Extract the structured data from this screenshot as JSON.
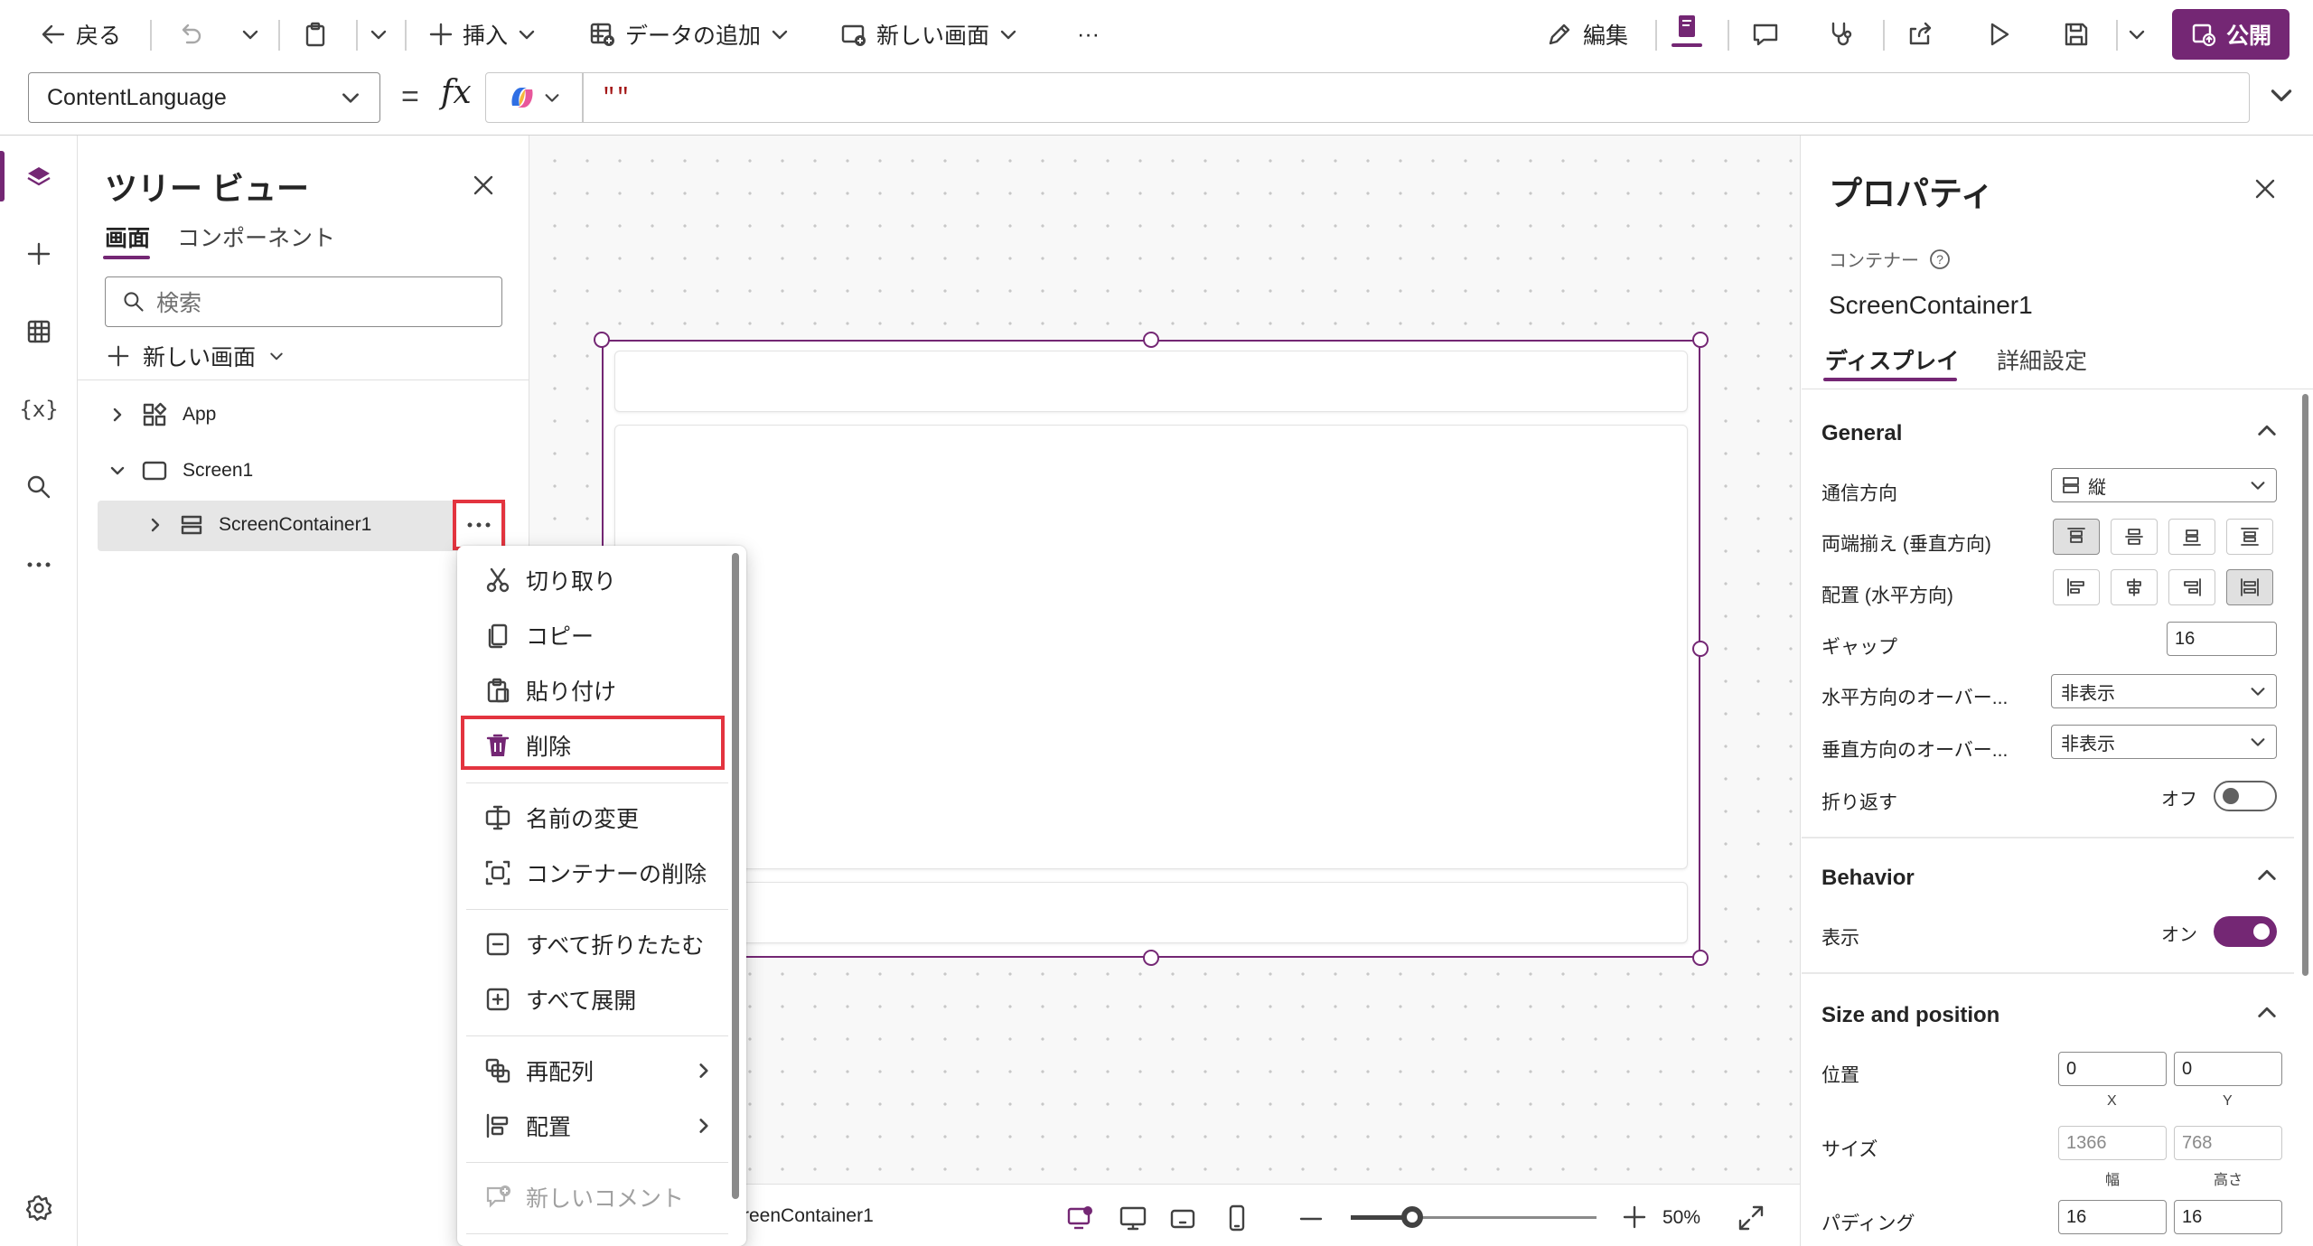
{
  "colors": {
    "accent": "#742774",
    "highlight": "#e3343f"
  },
  "toolbar": {
    "back_label": "戻る",
    "insert_label": "挿入",
    "add_data_label": "データの追加",
    "new_screen_label": "新しい画面",
    "more_label": "···",
    "edit_label": "編集",
    "publish_label": "公開"
  },
  "formula": {
    "property": "ContentLanguage",
    "equals": "=",
    "fx": "fx",
    "value": "\"\""
  },
  "tree": {
    "title": "ツリー ビュー",
    "tabs": [
      "画面",
      "コンポーネント"
    ],
    "search_placeholder": "検索",
    "new_screen_label": "新しい画面",
    "nodes": [
      "App",
      "Screen1",
      "ScreenContainer1"
    ]
  },
  "context_menu": {
    "items": [
      "切り取り",
      "コピー",
      "貼り付け",
      "削除",
      "名前の変更",
      "コンテナーの削除",
      "すべて折りたたむ",
      "すべて展開",
      "再配列",
      "配置",
      "新しいコメント"
    ]
  },
  "canvas": {
    "status_name": "reenContainer1",
    "zoom_value": "50%",
    "zoom_fraction": 0.25
  },
  "properties": {
    "title": "プロパティ",
    "control_type": "コンテナー",
    "control_name": "ScreenContainer1",
    "tabs": [
      "ディスプレイ",
      "詳細設定"
    ],
    "general": {
      "title": "General",
      "direction_label": "通信方向",
      "direction_value": "縦",
      "justify_label": "両端揃え (垂直方向)",
      "align_label": "配置 (水平方向)",
      "gap_label": "ギャップ",
      "gap_value": "16",
      "overflow_h_label": "水平方向のオーバー...",
      "overflow_h_value": "非表示",
      "overflow_v_label": "垂直方向のオーバー...",
      "overflow_v_value": "非表示",
      "wrap_label": "折り返す",
      "wrap_state": "オフ"
    },
    "behavior": {
      "title": "Behavior",
      "visible_label": "表示",
      "visible_state": "オン"
    },
    "size_position": {
      "title": "Size and position",
      "position_label": "位置",
      "x_value": "0",
      "y_value": "0",
      "x_label": "X",
      "y_label": "Y",
      "size_label": "サイズ",
      "width_value": "1366",
      "height_value": "768",
      "width_label": "幅",
      "height_label": "高さ",
      "padding_label": "パディング",
      "padding_1": "16",
      "padding_2": "16"
    }
  }
}
